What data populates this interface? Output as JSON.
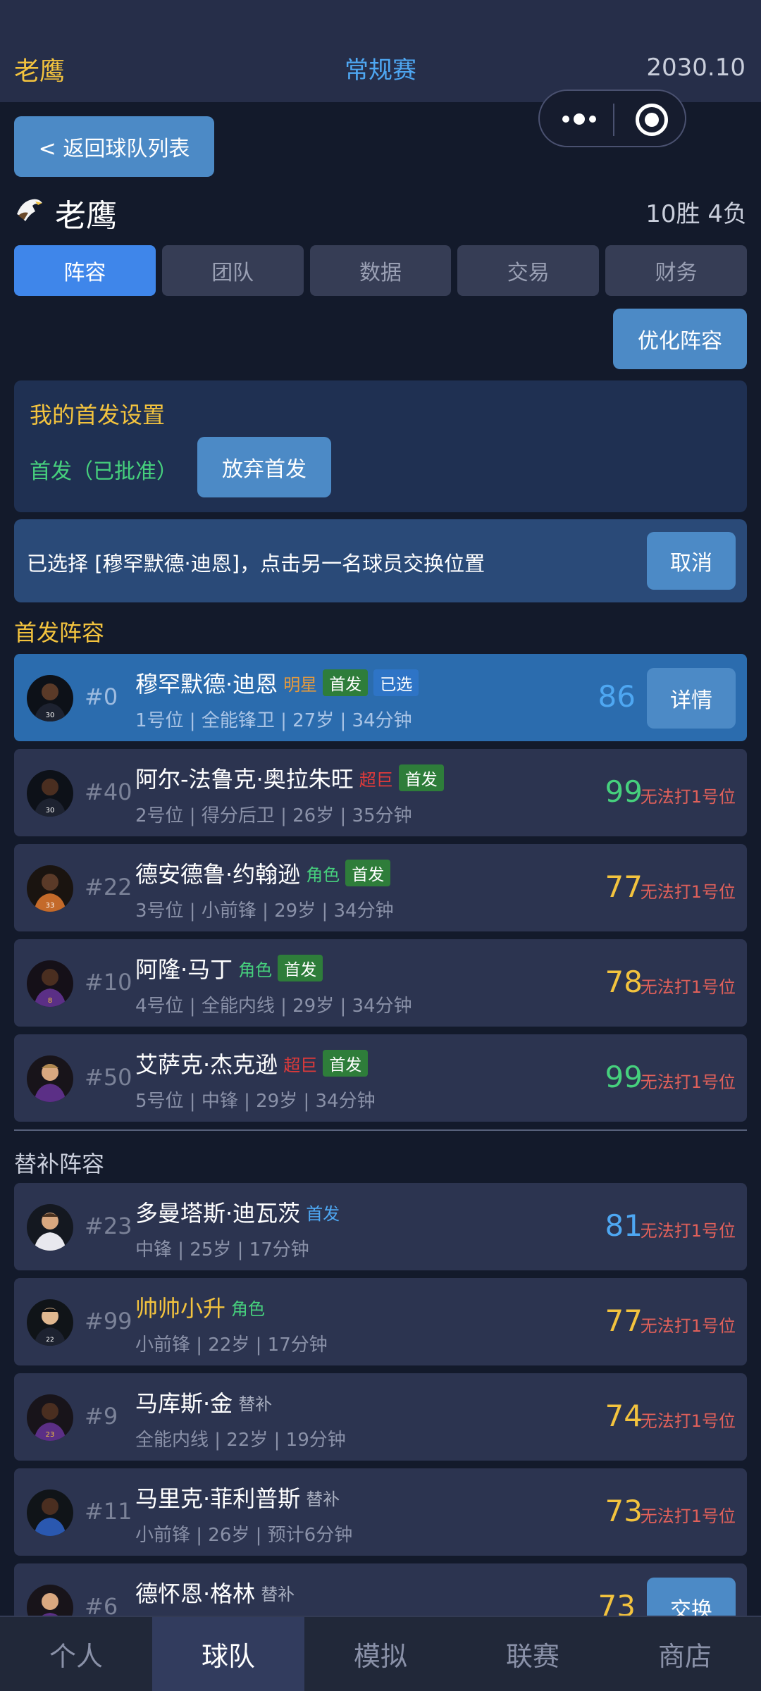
{
  "header": {
    "team": "老鹰",
    "season": "常规赛",
    "date": "2030.10"
  },
  "back_button": "< 返回球队列表",
  "team_header": {
    "name": "老鹰",
    "record": "10胜 4负",
    "emblem_icon": "eagle-icon"
  },
  "tabs": [
    {
      "label": "阵容",
      "active": true
    },
    {
      "label": "团队",
      "active": false
    },
    {
      "label": "数据",
      "active": false
    },
    {
      "label": "交易",
      "active": false
    },
    {
      "label": "财务",
      "active": false
    }
  ],
  "optimize_button": "优化阵容",
  "starter_settings": {
    "title": "我的首发设置",
    "status": "首发（已批准）",
    "give_up_button": "放弃首发"
  },
  "selection": {
    "message": "已选择 [穆罕默德·迪恩]，点击另一名球员交换位置",
    "cancel_button": "取消"
  },
  "starters_title": "首发阵容",
  "bench_title": "替补阵容",
  "starters": [
    {
      "number": "#0",
      "name": "穆罕默德·迪恩",
      "role": "明星",
      "badges": [
        "首发",
        "已选"
      ],
      "meta": "1号位 | 全能锋卫 | 27岁 | 34分钟",
      "rating": "86",
      "button": "详情"
    },
    {
      "number": "#40",
      "name": "阿尔-法鲁克·奥拉朱旺",
      "role": "超巨",
      "badges": [
        "首发"
      ],
      "meta": "2号位 | 得分后卫 | 26岁 | 35分钟",
      "rating": "99",
      "warning": "无法打1号位"
    },
    {
      "number": "#22",
      "name": "德安德鲁·约翰逊",
      "role": "角色",
      "badges": [
        "首发"
      ],
      "meta": "3号位 | 小前锋 | 29岁 | 34分钟",
      "rating": "77",
      "warning": "无法打1号位"
    },
    {
      "number": "#10",
      "name": "阿隆·马丁",
      "role": "角色",
      "badges": [
        "首发"
      ],
      "meta": "4号位 | 全能内线 | 29岁 | 34分钟",
      "rating": "78",
      "warning": "无法打1号位"
    },
    {
      "number": "#50",
      "name": "艾萨克·杰克逊",
      "role": "超巨",
      "badges": [
        "首发"
      ],
      "meta": "5号位 | 中锋 | 29岁 | 34分钟",
      "rating": "99",
      "warning": "无法打1号位"
    }
  ],
  "bench": [
    {
      "number": "#23",
      "name": "多曼塔斯·迪瓦茨",
      "role": "首发",
      "meta": "中锋 | 25岁 | 17分钟",
      "rating": "81",
      "warning": "无法打1号位"
    },
    {
      "number": "#99",
      "name": "帅帅小升",
      "role": "角色",
      "meta": "小前锋 | 22岁 | 17分钟",
      "rating": "77",
      "warning": "无法打1号位"
    },
    {
      "number": "#9",
      "name": "马库斯·金",
      "role": "替补",
      "meta": "全能内线 | 22岁 | 19分钟",
      "rating": "74",
      "warning": "无法打1号位"
    },
    {
      "number": "#11",
      "name": "马里克·菲利普斯",
      "role": "替补",
      "meta": "小前锋 | 26岁 | 预计6分钟",
      "rating": "73",
      "warning": "无法打1号位"
    },
    {
      "number": "#6",
      "name": "德怀恩·格林",
      "role": "替补",
      "meta": "",
      "rating": "73",
      "button": "交换"
    }
  ],
  "bottom_nav": [
    {
      "label": "个人",
      "active": false
    },
    {
      "label": "球队",
      "active": true
    },
    {
      "label": "模拟",
      "active": false
    },
    {
      "label": "联赛",
      "active": false
    },
    {
      "label": "商店",
      "active": false
    }
  ],
  "colors": {
    "accent_blue": "#3f86ea",
    "gold": "#f3c33e",
    "green": "#46d07d",
    "red_warning": "#e0605a",
    "background": "#131a2b"
  }
}
